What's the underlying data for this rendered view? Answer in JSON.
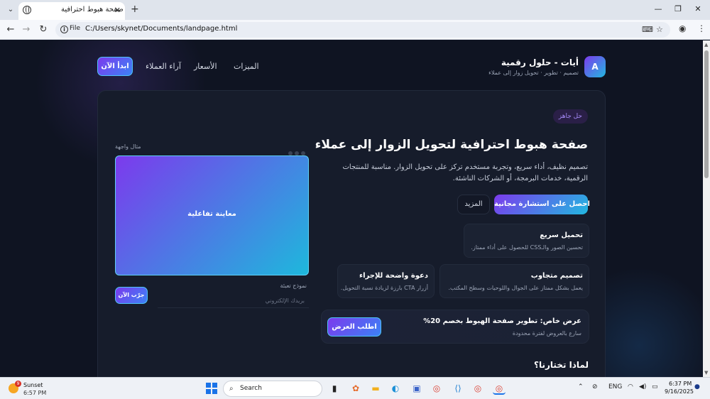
{
  "browser": {
    "tab_title": "صفحة هبوط احترافية",
    "file_chip": "File",
    "url": "C:/Users/skynet/Documents/landpage.html"
  },
  "site": {
    "logo_letter": "A",
    "brand_name": "أيات - حلول رقمية",
    "brand_tagline": "تصميم · تطوير · تحويل زوار إلى عملاء",
    "nav": [
      "المیزات",
      "الأسعار",
      "آراء العملاء"
    ],
    "cta_top": "ابدأ الآن"
  },
  "hero": {
    "badge": "حل جاهز",
    "title": "صفحة هبوط احترافية لتحويل الزوار إلى عملاء",
    "description": "تصميم نظيف، أداء سريع، وتجربة مستخدم تركز على تحويل الزوار. مناسبة للمنتجات الرقمية، خدمات البرمجة، أو الشركات الناشئة.",
    "primary_button": "احصل على استشارة مجانية",
    "secondary_button": "المزيد",
    "features": [
      {
        "title": "تحميل سريع",
        "desc": "تحسين الصور والـCSS للحصول على أداء ممتاز."
      },
      {
        "title": "تصميم متجاوب",
        "desc": "يعمل بشكل ممتاز على الجوال واللوحيات وسطح المكتب."
      },
      {
        "title": "دعوة واضحة للإجراء",
        "desc": "أزرار CTA بارزة لزيادة نسبة التحويل."
      }
    ],
    "offer": {
      "title": "عرض خاص: تطوير صفحة الهبوط بخصم 20%",
      "subtitle": "سارع بالعروض لفترة محدودة",
      "button": "اطلب العرض"
    },
    "preview": {
      "label": "مثال واجهة",
      "box_text": "معاينة تفاعلية",
      "form_label": "نموذج تعبئة",
      "input_placeholder": "بريدك الإلكتروني",
      "form_button": "جرّب الآن"
    }
  },
  "section": {
    "why_title": "لماذا تختارنا؟"
  },
  "taskbar": {
    "weather_title": "Sunset",
    "weather_time": "6:57 PM",
    "weather_badge": "9",
    "search_label": "Search",
    "language": "ENG",
    "clock_time": "6:37 PM",
    "clock_date": "9/16/2025"
  },
  "icons": [
    "globe-icon",
    "info-icon",
    "translate-icon",
    "star-icon",
    "profile-icon",
    "kebab-menu-icon",
    "search-icon",
    "wifi-icon",
    "volume-icon",
    "battery-icon",
    "bell-icon"
  ],
  "colors": {
    "accent_purple": "#7c3aed",
    "accent_cyan": "#22b8e0",
    "page_bg": "#0f1422",
    "card_bg": "#161c2b"
  }
}
